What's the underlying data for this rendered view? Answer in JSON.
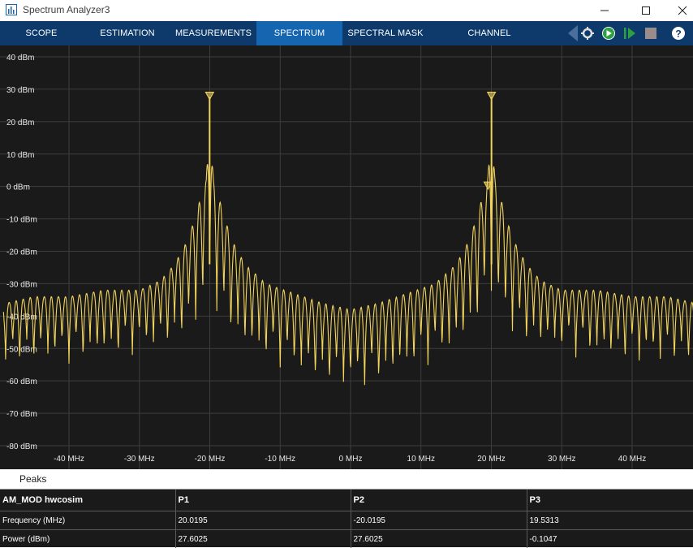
{
  "window": {
    "title": "Spectrum Analyzer3"
  },
  "tabs": [
    {
      "label": "SCOPE"
    },
    {
      "label": "ESTIMATION"
    },
    {
      "label": "MEASUREMENTS"
    },
    {
      "label": "SPECTRUM"
    },
    {
      "label": "SPECTRAL MASK"
    },
    {
      "label": "CHANNEL MEASUREMENTS"
    }
  ],
  "active_tab": "SPECTRUM",
  "toolbar_icons": [
    "settings-icon",
    "run-icon",
    "step-forward-icon",
    "stop-icon",
    "help-icon"
  ],
  "colors": {
    "trace": "#f2d45c",
    "background": "#1a1a1a",
    "toolbar": "#0d3a6b",
    "active_tab": "#1565b0"
  },
  "chart_data": {
    "type": "line",
    "y_ticks": [
      "40 dBm",
      "30 dBm",
      "20 dBm",
      "10 dBm",
      "0 dBm",
      "-10 dBm",
      "-20 dBm",
      "-30 dBm",
      "-40 dBm",
      "-50 dBm",
      "-60 dBm",
      "-70 dBm",
      "-80 dBm"
    ],
    "x_ticks": [
      "-40 MHz",
      "-30 MHz",
      "-20 MHz",
      "-10 MHz",
      "0 MHz",
      "10 MHz",
      "20 MHz",
      "30 MHz",
      "40 MHz"
    ],
    "ylim": [
      -85,
      43
    ],
    "xlim": [
      -49.3,
      49.3
    ],
    "grid": true,
    "x_unit": "MHz",
    "y_unit": "dBm",
    "series": [
      {
        "peaks": [
          {
            "x": -20.0195,
            "y": 27.6
          },
          {
            "x": 20.0195,
            "y": 27.6
          },
          {
            "x": 19.5313,
            "y": -0.1
          }
        ],
        "envelope": [
          [
            -49,
            -36
          ],
          [
            -45,
            -34
          ],
          [
            -40,
            -34
          ],
          [
            -35,
            -32
          ],
          [
            -30,
            -32
          ],
          [
            -27,
            -29
          ],
          [
            -25,
            -24
          ],
          [
            -23,
            -16
          ],
          [
            -21.5,
            -5
          ],
          [
            -20.5,
            2
          ],
          [
            -20,
            27.6
          ],
          [
            -19.5,
            2
          ],
          [
            -18.5,
            -5
          ],
          [
            -17,
            -16
          ],
          [
            -15,
            -24
          ],
          [
            -12,
            -30
          ],
          [
            -8,
            -33
          ],
          [
            -4,
            -36
          ],
          [
            0,
            -38
          ],
          [
            4,
            -36
          ],
          [
            8,
            -33
          ],
          [
            12,
            -30
          ],
          [
            15,
            -24
          ],
          [
            17,
            -16
          ],
          [
            18.5,
            -5
          ],
          [
            19.5,
            2
          ],
          [
            20,
            27.6
          ],
          [
            20.5,
            2
          ],
          [
            21.5,
            -5
          ],
          [
            23,
            -16
          ],
          [
            25,
            -24
          ],
          [
            27,
            -29
          ],
          [
            30,
            -32
          ],
          [
            35,
            -32
          ],
          [
            40,
            -34
          ],
          [
            45,
            -34
          ],
          [
            49,
            -36
          ]
        ],
        "nulls": [
          [
            -49,
            -52
          ],
          [
            -45,
            -51
          ],
          [
            -40,
            -51
          ],
          [
            -35,
            -50
          ],
          [
            -30,
            -48
          ],
          [
            -25,
            -46
          ],
          [
            -22,
            -40
          ],
          [
            -20,
            -30
          ],
          [
            -18,
            -40
          ],
          [
            -15,
            -48
          ],
          [
            -10,
            -52
          ],
          [
            -5,
            -57
          ],
          [
            0,
            -59
          ],
          [
            5,
            -57
          ],
          [
            10,
            -52
          ],
          [
            15,
            -48
          ],
          [
            18,
            -40
          ],
          [
            20,
            -30
          ],
          [
            22,
            -40
          ],
          [
            25,
            -46
          ],
          [
            30,
            -48
          ],
          [
            35,
            -50
          ],
          [
            40,
            -51
          ],
          [
            45,
            -51
          ],
          [
            49,
            -52
          ]
        ]
      }
    ]
  },
  "peaks_panel": {
    "title": "Peaks",
    "headers": [
      "AM_MOD hwcosim",
      "P1",
      "P2",
      "P3"
    ],
    "rows": [
      [
        "Frequency (MHz)",
        "20.0195",
        "-20.0195",
        "19.5313"
      ],
      [
        "Power (dBm)",
        "27.6025",
        "27.6025",
        "-0.1047"
      ]
    ]
  }
}
